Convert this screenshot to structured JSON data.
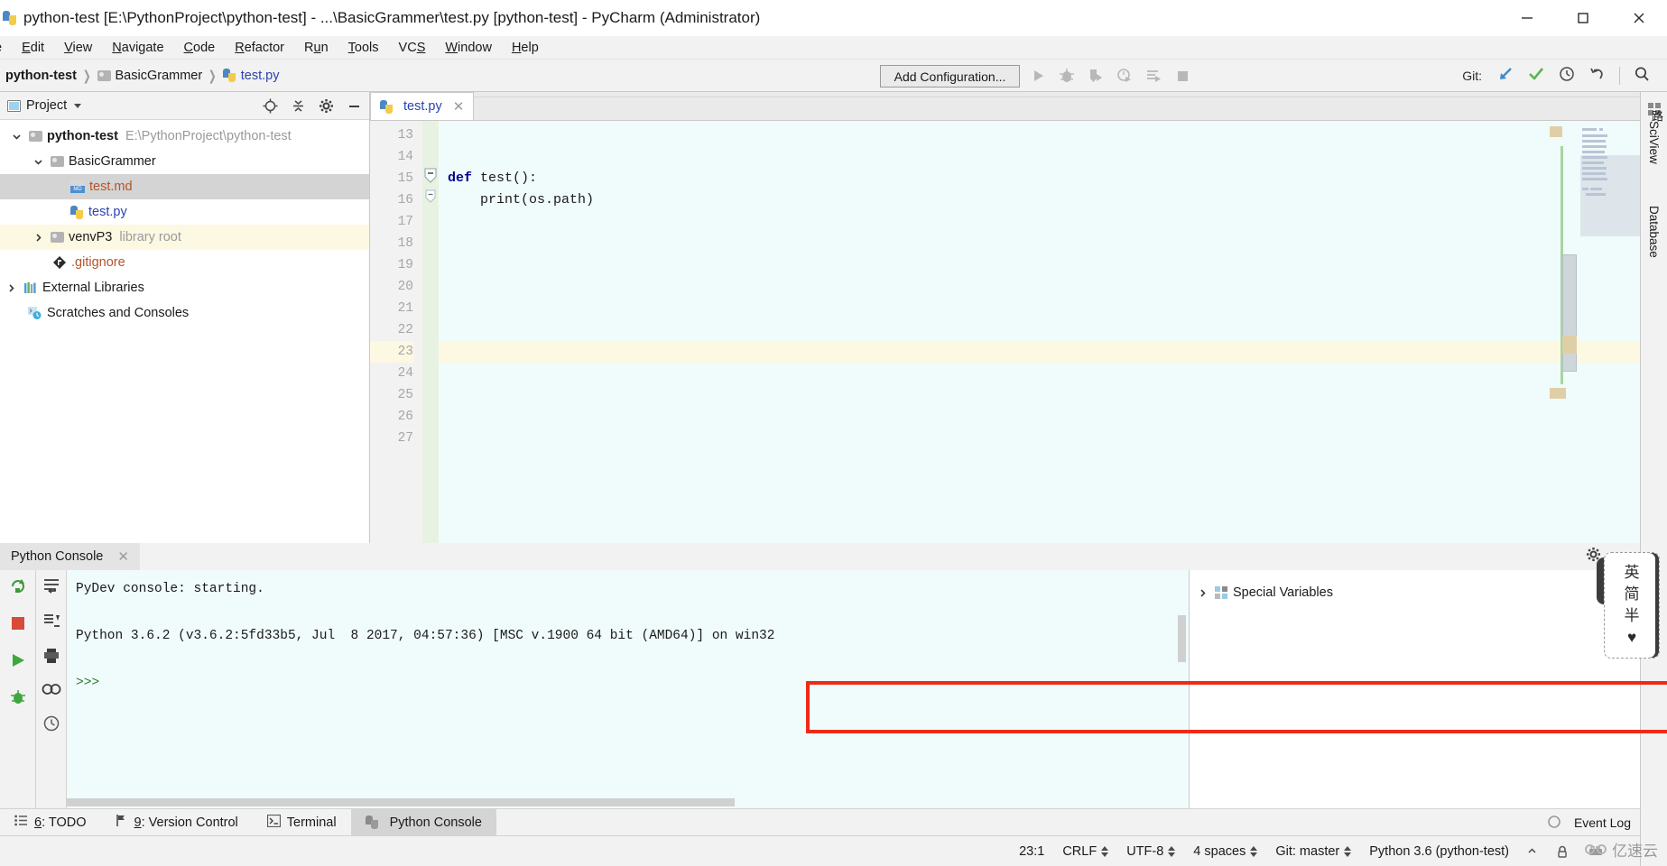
{
  "window": {
    "title": "python-test [E:\\PythonProject\\python-test] - ...\\BasicGrammer\\test.py [python-test] - PyCharm (Administrator)",
    "minimize_label": "—",
    "maximize_label": "□",
    "close_label": "✕"
  },
  "menubar": {
    "items": [
      {
        "label": "e",
        "clipped": true
      },
      {
        "pre": "",
        "mnemonic": "E",
        "post": "dit",
        "label": "Edit"
      },
      {
        "pre": "",
        "mnemonic": "V",
        "post": "iew",
        "label": "View"
      },
      {
        "pre": "",
        "mnemonic": "N",
        "post": "avigate",
        "label": "Navigate"
      },
      {
        "pre": "",
        "mnemonic": "C",
        "post": "ode",
        "label": "Code"
      },
      {
        "pre": "",
        "mnemonic": "R",
        "post": "efactor",
        "label": "Refactor"
      },
      {
        "pre": "R",
        "mnemonic": "u",
        "post": "n",
        "label": "Run"
      },
      {
        "pre": "",
        "mnemonic": "T",
        "post": "ools",
        "label": "Tools"
      },
      {
        "pre": "VC",
        "mnemonic": "S",
        "post": "",
        "label": "VCS"
      },
      {
        "pre": "",
        "mnemonic": "W",
        "post": "indow",
        "label": "Window"
      },
      {
        "pre": "",
        "mnemonic": "H",
        "post": "elp",
        "label": "Help"
      }
    ]
  },
  "navbar": {
    "breadcrumbs": [
      {
        "label": "python-test",
        "style": "bold",
        "icon": "none"
      },
      {
        "label": "BasicGrammer",
        "style": "plain",
        "icon": "folder-icon"
      },
      {
        "label": "test.py",
        "style": "link",
        "icon": "python-file-icon"
      }
    ],
    "add_configuration_label": "Add Configuration...",
    "run_icons": [
      "run-icon",
      "debug-icon",
      "coverage-icon",
      "profile-icon",
      "run-with-console-icon",
      "stop-icon"
    ],
    "git_label": "Git:",
    "git_icons": [
      "update-project-icon",
      "commit-icon",
      "history-icon",
      "rollback-icon",
      "search-everywhere-icon"
    ]
  },
  "project_panel": {
    "title": "Project",
    "head_icons": [
      "locate-icon",
      "collapse-all-icon",
      "settings-gear-icon",
      "hide-icon"
    ],
    "tree": [
      {
        "label": "python-test",
        "detail": "E:\\PythonProject\\python-test",
        "indent": 0,
        "chevron": "down",
        "icon": "folder-icon",
        "style": "bold",
        "state": "normal"
      },
      {
        "label": "BasicGrammer",
        "detail": "",
        "indent": 1,
        "chevron": "down",
        "icon": "folder-icon",
        "style": "plain",
        "state": "normal"
      },
      {
        "label": "test.md",
        "detail": "",
        "indent": 2,
        "chevron": "none",
        "icon": "markdown-file-icon",
        "style": "orange",
        "state": "selected"
      },
      {
        "label": "test.py",
        "detail": "",
        "indent": 2,
        "chevron": "none",
        "icon": "python-file-icon",
        "style": "blue",
        "state": "normal"
      },
      {
        "label": "venvP3",
        "detail": "library root",
        "indent": 1,
        "chevron": "right",
        "icon": "folder-icon",
        "style": "plain",
        "state": "highlighted"
      },
      {
        "label": ".gitignore",
        "detail": "",
        "indent": 2,
        "chevron": "none",
        "icon": "gitignore-icon",
        "style": "orange",
        "state": "normal"
      },
      {
        "label": "External Libraries",
        "detail": "",
        "indent": 0,
        "chevron": "right",
        "icon": "libraries-icon",
        "style": "plain",
        "state": "normal"
      },
      {
        "label": "Scratches and Consoles",
        "detail": "",
        "indent": 0,
        "chevron": "none",
        "icon": "scratches-icon",
        "style": "plain",
        "state": "normal"
      }
    ]
  },
  "editor": {
    "tabs": [
      {
        "label": "test.py",
        "icon": "python-file-icon",
        "active": true,
        "close": "✕"
      }
    ],
    "first_line_number": 13,
    "lines": [
      {
        "num": 13,
        "text": "",
        "current": false,
        "fold": "none"
      },
      {
        "num": 14,
        "text": "",
        "current": false,
        "fold": "none"
      },
      {
        "num": 15,
        "text": "def test():",
        "current": false,
        "fold": "minus",
        "keyword": "def"
      },
      {
        "num": 16,
        "text": "    print(os.path)",
        "current": false,
        "fold": "minus-small"
      },
      {
        "num": 17,
        "text": "",
        "current": false,
        "fold": "none"
      },
      {
        "num": 18,
        "text": "",
        "current": false,
        "fold": "none"
      },
      {
        "num": 19,
        "text": "",
        "current": false,
        "fold": "none"
      },
      {
        "num": 20,
        "text": "",
        "current": false,
        "fold": "none"
      },
      {
        "num": 21,
        "text": "",
        "current": false,
        "fold": "none"
      },
      {
        "num": 22,
        "text": "",
        "current": false,
        "fold": "none"
      },
      {
        "num": 23,
        "text": "",
        "current": true,
        "fold": "none"
      },
      {
        "num": 24,
        "text": "",
        "current": false,
        "fold": "none"
      },
      {
        "num": 25,
        "text": "",
        "current": false,
        "fold": "none"
      },
      {
        "num": 26,
        "text": "",
        "current": false,
        "fold": "none"
      },
      {
        "num": 27,
        "text": "",
        "current": false,
        "fold": "none"
      }
    ]
  },
  "right_strip": {
    "tabs": [
      {
        "label": "SciView",
        "icon": "grid-icon"
      },
      {
        "label": "Database",
        "icon": "database-icon"
      }
    ]
  },
  "console": {
    "tab_label": "Python Console",
    "tab_close": "✕",
    "head_icons": [
      "settings-gear-icon",
      "hide-icon"
    ],
    "left_tools": [
      "rerun-icon",
      "stop-icon",
      "execute-icon",
      "debug-console-icon"
    ],
    "left_tools2": [
      "soft-wrap-icon",
      "scroll-to-end-icon",
      "print-icon",
      "show-variables-icon",
      "history-icon"
    ],
    "output": [
      {
        "text": "PyDev console: starting.",
        "kind": "plain"
      },
      {
        "text": "",
        "kind": "plain"
      },
      {
        "text": "Python 3.6.2 (v3.6.2:5fd33b5, Jul  8 2017, 04:57:36) [MSC v.1900 64 bit (AMD64)] on win32",
        "kind": "plain"
      },
      {
        "text": "",
        "kind": "plain"
      },
      {
        "text": ">>>",
        "kind": "prompt"
      }
    ],
    "variables": {
      "rows": [
        {
          "label": "Special Variables",
          "chevron": "right",
          "icon": "special-variables-icon"
        }
      ]
    }
  },
  "bottom_tabs": {
    "items": [
      {
        "num": "6",
        "label": ": TODO",
        "icon": "todo-icon",
        "active": false
      },
      {
        "num": "9",
        "label": ": Version Control",
        "icon": "version-control-icon",
        "active": false
      },
      {
        "num": "",
        "label": "Terminal",
        "icon": "terminal-icon",
        "active": false
      },
      {
        "num": "",
        "label": "Python Console",
        "icon": "python-console-icon",
        "active": true
      }
    ],
    "event_log_label": "Event Log"
  },
  "statusbar": {
    "items": [
      {
        "label": "23:1",
        "spinner": false,
        "name": "caret-position"
      },
      {
        "label": "CRLF",
        "spinner": true,
        "name": "line-separator"
      },
      {
        "label": "UTF-8",
        "spinner": true,
        "name": "file-encoding"
      },
      {
        "label": "4 spaces",
        "spinner": true,
        "name": "indent-setting"
      },
      {
        "label": "Git: master",
        "spinner": true,
        "name": "git-branch"
      },
      {
        "label": "Python 3.6 (python-test)",
        "spinner": false,
        "name": "python-interpreter"
      }
    ],
    "trailing_icons": [
      "caret-up-icon",
      "lock-icon",
      "memory-icon"
    ]
  },
  "overlays": {
    "ime": {
      "chars": [
        "英",
        "简",
        "半"
      ],
      "heart": "♥"
    },
    "watermark": "亿速云",
    "sidenote": "路"
  },
  "colors": {
    "accent_blue": "#2a43b0",
    "orange_file": "#b4552a",
    "highlight_yellow": "#fcf8e2",
    "selection_gray": "#d4d4d4",
    "editor_bg": "#f0fbfb",
    "red_box": "#ee2a18",
    "git_blue": "#3d8ad0",
    "git_green": "#5ab552"
  }
}
